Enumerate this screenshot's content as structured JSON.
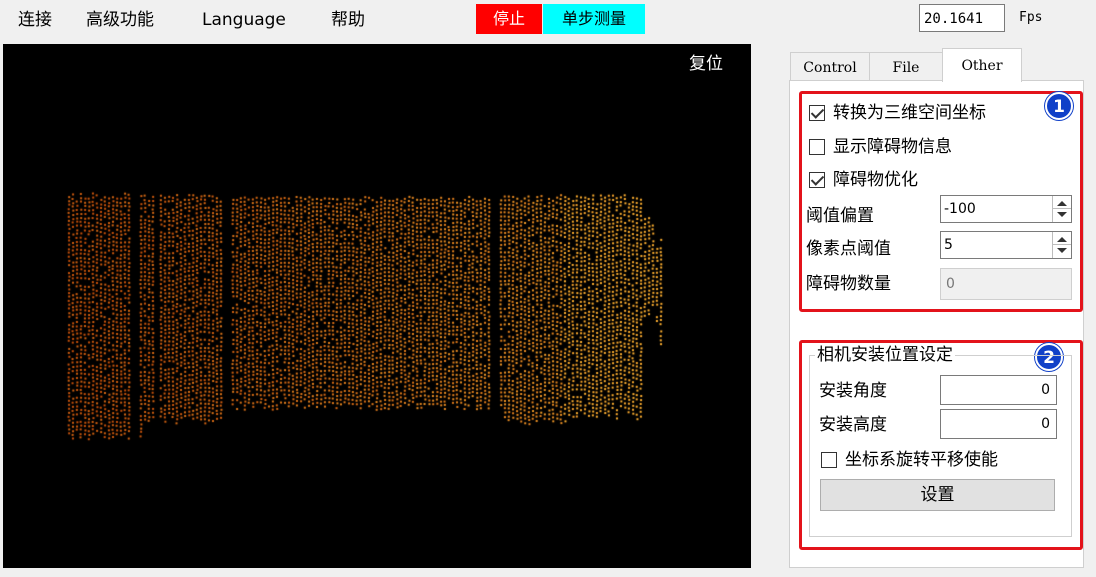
{
  "menu": {
    "connect": "连接",
    "advanced": "高级功能",
    "language": "Language",
    "help": "帮助"
  },
  "toolbar": {
    "stop_label": "停止",
    "step_measure_label": "单步测量",
    "fps_value": "20.1641",
    "fps_label": "Fps"
  },
  "viewer": {
    "reset_label": "复位"
  },
  "tabs": [
    {
      "label": "Control",
      "active": false
    },
    {
      "label": "File",
      "active": false
    },
    {
      "label": "Other",
      "active": true
    }
  ],
  "other": {
    "badge1": "1",
    "badge2": "2",
    "convert_3d": {
      "label": "转换为三维空间坐标",
      "checked": true
    },
    "show_obstacle": {
      "label": "显示障碍物信息",
      "checked": false
    },
    "obstacle_opt": {
      "label": "障碍物优化",
      "checked": true
    },
    "threshold_offset": {
      "label": "阈值偏置",
      "value": "-100"
    },
    "pixel_threshold": {
      "label": "像素点阈值",
      "value": "5"
    },
    "obstacle_count": {
      "label": "障碍物数量",
      "value": "0"
    },
    "camera_group": {
      "title": "相机安装位置设定",
      "angle": {
        "label": "安装角度",
        "value": "0"
      },
      "height": {
        "label": "安装高度",
        "value": "0"
      },
      "enable_transform": {
        "label": "坐标系旋转平移使能",
        "checked": false
      },
      "set_button": "设置"
    }
  },
  "colors": {
    "stop_bg": "#ff0000",
    "step_bg": "#00ffff",
    "highlight": "#e3131b",
    "badge": "#1040c8",
    "cloud_dark": "#c8500a",
    "cloud_light": "#ffb030"
  }
}
